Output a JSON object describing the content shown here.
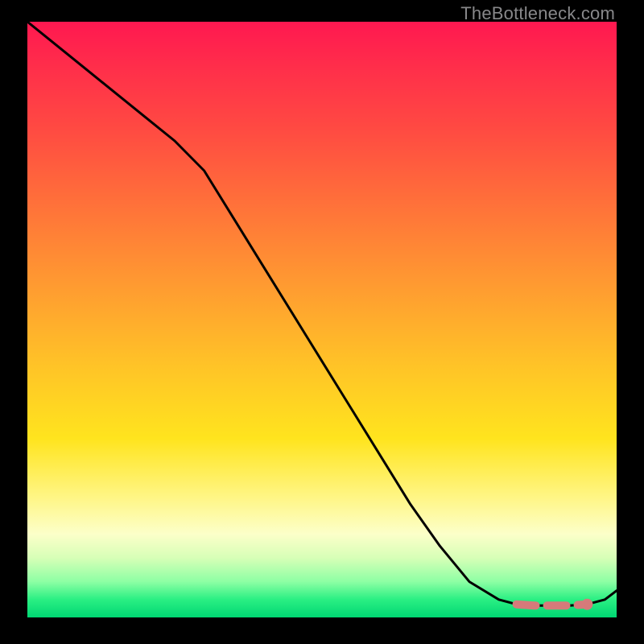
{
  "watermark": "TheBottleneck.com",
  "chart_data": {
    "type": "line",
    "title": "",
    "xlabel": "",
    "ylabel": "",
    "xlim": [
      0,
      100
    ],
    "ylim": [
      0,
      100
    ],
    "series": [
      {
        "name": "bottleneck-curve",
        "x": [
          0,
          5,
          10,
          15,
          20,
          25,
          30,
          35,
          40,
          45,
          50,
          55,
          60,
          65,
          70,
          75,
          80,
          83,
          86,
          89,
          92,
          95,
          98,
          100
        ],
        "y": [
          100,
          96,
          92,
          88,
          84,
          80,
          75,
          67,
          59,
          51,
          43,
          35,
          27,
          19,
          12,
          6,
          3,
          2.2,
          2.0,
          2.0,
          2.0,
          2.2,
          3.0,
          4.5
        ]
      }
    ],
    "highlight": {
      "name": "flat-zone",
      "x": [
        83,
        86,
        89,
        92,
        95
      ],
      "y": [
        2.2,
        2.0,
        2.0,
        2.0,
        2.2
      ]
    },
    "colors": {
      "curve": "#000000",
      "highlight": "#d67a7a"
    }
  }
}
